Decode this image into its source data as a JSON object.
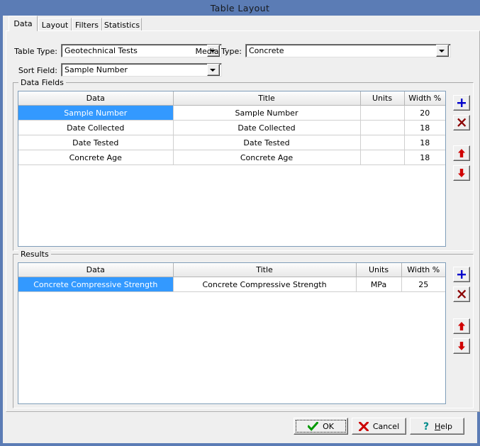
{
  "window": {
    "title": "Table Layout",
    "accent_color": "#5b7cb5",
    "face_color": "#efefef",
    "selection_color": "#3399ff"
  },
  "tabs": [
    {
      "label": "Data",
      "selected": true
    },
    {
      "label": "Layout",
      "selected": false
    },
    {
      "label": "Filters",
      "selected": false
    },
    {
      "label": "Statistics",
      "selected": false
    }
  ],
  "form": {
    "table_type": {
      "label": "Table Type:",
      "value": "Geotechnical Tests"
    },
    "media_type": {
      "label": "Media Type:",
      "value": "Concrete"
    },
    "sort_field": {
      "label": "Sort Field:",
      "value": "Sample Number"
    }
  },
  "data_fields": {
    "group_title": "Data Fields",
    "columns": [
      "Data",
      "Title",
      "Units",
      "Width %"
    ],
    "rows": [
      {
        "data": "Sample Number",
        "title": "Sample Number",
        "units": "",
        "width": "20",
        "selected": true
      },
      {
        "data": "Date Collected",
        "title": "Date Collected",
        "units": "",
        "width": "18",
        "selected": false
      },
      {
        "data": "Date Tested",
        "title": "Date Tested",
        "units": "",
        "width": "18",
        "selected": false
      },
      {
        "data": "Concrete Age",
        "title": "Concrete Age",
        "units": "",
        "width": "18",
        "selected": false
      }
    ],
    "buttons": [
      {
        "name": "add",
        "icon": "plus-icon",
        "color": "#0000cc"
      },
      {
        "name": "delete",
        "icon": "cross-icon",
        "color": "#8b0000"
      },
      {
        "name": "move-up",
        "icon": "arrow-up-icon",
        "color": "#d00000"
      },
      {
        "name": "move-down",
        "icon": "arrow-down-icon",
        "color": "#d00000"
      }
    ]
  },
  "results": {
    "group_title": "Results",
    "columns": [
      "Data",
      "Title",
      "Units",
      "Width %"
    ],
    "rows": [
      {
        "data": "Concrete Compressive Strength",
        "title": "Concrete Compressive Strength",
        "units": "MPa",
        "width": "25",
        "selected": true
      }
    ],
    "buttons": [
      {
        "name": "add",
        "icon": "plus-icon",
        "color": "#0000cc"
      },
      {
        "name": "delete",
        "icon": "cross-icon",
        "color": "#8b0000"
      },
      {
        "name": "move-up",
        "icon": "arrow-up-icon",
        "color": "#d00000"
      },
      {
        "name": "move-down",
        "icon": "arrow-down-icon",
        "color": "#d00000"
      }
    ]
  },
  "footer": {
    "ok": {
      "label": "OK",
      "icon": "check-icon",
      "color": "#009900",
      "focused": true
    },
    "cancel": {
      "label": "Cancel",
      "icon": "cross-icon",
      "color": "#cc0000",
      "focused": false
    },
    "help": {
      "label": "Help",
      "icon": "question-icon",
      "color": "#008b8b",
      "focused": false
    }
  }
}
